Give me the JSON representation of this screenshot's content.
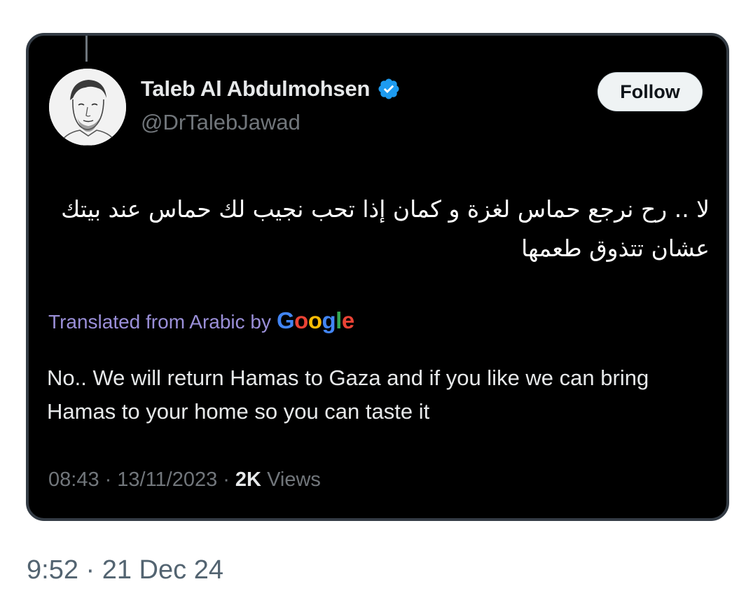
{
  "tweet": {
    "author": {
      "display_name": "Taleb Al Abdulmohsen",
      "handle": "@DrTalebJawad",
      "verified": true,
      "verified_color": "#1d9bf0",
      "avatar_icon": "avatar-sketch"
    },
    "follow_label": "Follow",
    "text_arabic": "لا .. رح نرجع حماس لغزة و كمان إذا تحب نجيب لك حماس عند بيتك عشان تتذوق طعمها",
    "translation": {
      "label": "Translated from Arabic by",
      "provider_letters": [
        "G",
        "o",
        "o",
        "g",
        "l",
        "e"
      ],
      "text": "No.. We will return Hamas to Gaza and if you like we can bring Hamas to your home so you can taste it"
    },
    "meta": {
      "time": "08:43",
      "separator": "·",
      "date": "13/11/2023",
      "views_count": "2K",
      "views_label": "Views"
    }
  },
  "post_timestamp": "9:52 · 21 Dec 24",
  "colors": {
    "card_background": "#000000",
    "card_border": "#343c45",
    "translated_label": "#9a8fd8",
    "muted_text": "#71767b"
  }
}
